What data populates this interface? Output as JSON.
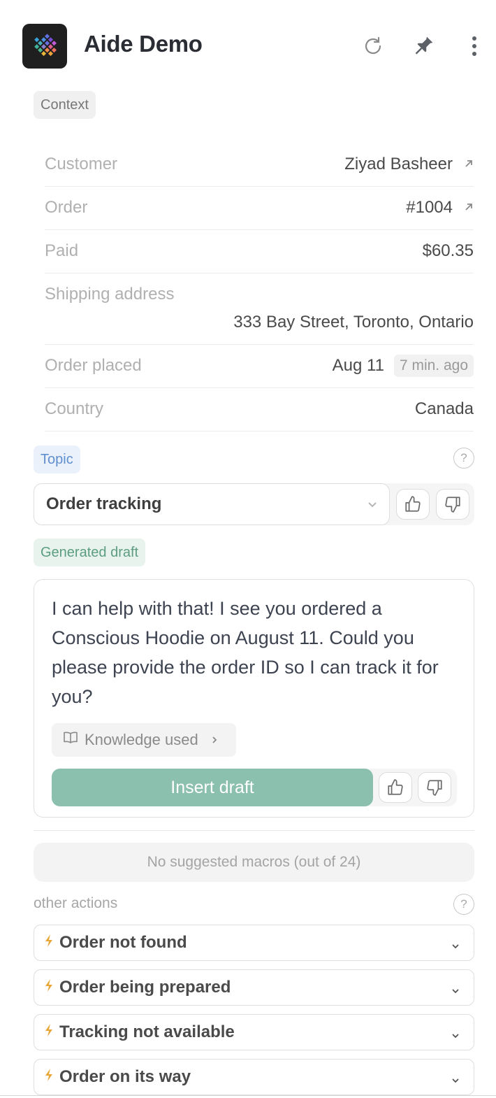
{
  "header": {
    "app_title": "Aide Demo",
    "refresh_icon": "refresh-icon",
    "pin_icon": "pin-icon",
    "more_icon": "more-vertical-icon"
  },
  "context": {
    "tag": "Context",
    "rows": [
      {
        "label": "Customer",
        "value": "Ziyad Basheer",
        "link": true
      },
      {
        "label": "Order",
        "value": "#1004",
        "link": true
      },
      {
        "label": "Paid",
        "value": "$60.35"
      },
      {
        "label": "Shipping address",
        "value": "333 Bay Street, Toronto, Ontario"
      },
      {
        "label": "Order placed",
        "value": "Aug 11",
        "relative": "7 min. ago"
      },
      {
        "label": "Country",
        "value": "Canada"
      }
    ]
  },
  "topic": {
    "tag": "Topic",
    "help": "?",
    "selected": "Order tracking"
  },
  "draft": {
    "tag": "Generated draft",
    "text": "I can help with that! I see you ordered a Conscious Hoodie on August 11. Could you please provide the order ID so I can track it for you?",
    "knowledge_label": "Knowledge used",
    "insert_label": "Insert draft"
  },
  "macros": {
    "empty_text": "No suggested macros (out of 24)"
  },
  "other_actions": {
    "label": "other actions",
    "help": "?",
    "items": [
      {
        "label": "Order not found"
      },
      {
        "label": "Order being prepared"
      },
      {
        "label": "Tracking not available"
      },
      {
        "label": "Order on its way"
      }
    ]
  },
  "colors": {
    "topic_accent": "#5f8fcf",
    "draft_accent": "#5c9d82",
    "insert_button": "#8bbfae",
    "bolt": "#e7a73a"
  }
}
